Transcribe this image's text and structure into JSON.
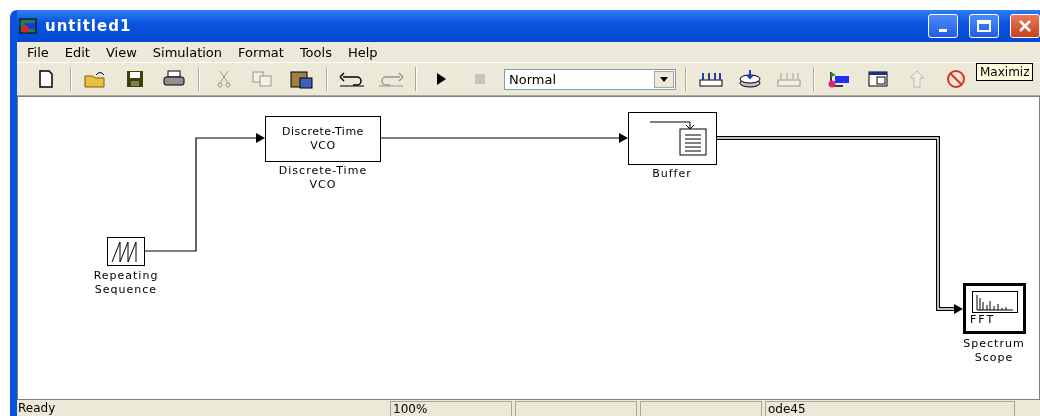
{
  "window": {
    "title": "untitled1"
  },
  "menu": [
    {
      "label": "File"
    },
    {
      "label": "Edit"
    },
    {
      "label": "View"
    },
    {
      "label": "Simulation"
    },
    {
      "label": "Format"
    },
    {
      "label": "Tools"
    },
    {
      "label": "Help"
    }
  ],
  "toolbar": [
    {
      "kind": "button",
      "disabled": false
    },
    {
      "kind": "separator"
    },
    {
      "kind": "button",
      "disabled": false
    },
    {
      "kind": "button",
      "disabled": false
    },
    {
      "kind": "button",
      "disabled": false
    },
    {
      "kind": "separator"
    },
    {
      "kind": "button",
      "disabled": true
    },
    {
      "kind": "button",
      "disabled": true
    },
    {
      "kind": "button",
      "disabled": false
    },
    {
      "kind": "separator"
    },
    {
      "kind": "button",
      "disabled": false
    },
    {
      "kind": "button",
      "disabled": true
    },
    {
      "kind": "separator"
    },
    {
      "kind": "button",
      "disabled": false
    },
    {
      "kind": "button",
      "disabled": true
    },
    {
      "kind": "select",
      "value": "Normal"
    },
    {
      "kind": "separator"
    },
    {
      "kind": "button",
      "disabled": false
    },
    {
      "kind": "button",
      "disabled": false
    },
    {
      "kind": "button",
      "disabled": true
    },
    {
      "kind": "separator"
    },
    {
      "kind": "button",
      "disabled": false
    },
    {
      "kind": "button",
      "disabled": false
    },
    {
      "kind": "button",
      "disabled": true
    },
    {
      "kind": "button",
      "disabled": false
    }
  ],
  "tooltip": "Maximiz",
  "diagram": {
    "blocks": [
      {
        "kind": "repeating-sequence",
        "label": [
          "Repeating",
          "Sequence"
        ]
      },
      {
        "kind": "vco",
        "text": [
          "Discrete-Time",
          "VCO"
        ],
        "label": [
          "Discrete-Time",
          "VCO"
        ]
      },
      {
        "kind": "buffer",
        "label": [
          "Buffer"
        ]
      },
      {
        "kind": "spectrum-scope",
        "text": [
          "FFT"
        ],
        "label": [
          "Spectrum",
          "Scope"
        ]
      }
    ],
    "connections": [
      {
        "kind": "scalar"
      },
      {
        "kind": "scalar"
      },
      {
        "kind": "frame"
      }
    ]
  },
  "status_bar": {
    "message": "Ready",
    "zoom": "100%",
    "solver": "ode45"
  }
}
